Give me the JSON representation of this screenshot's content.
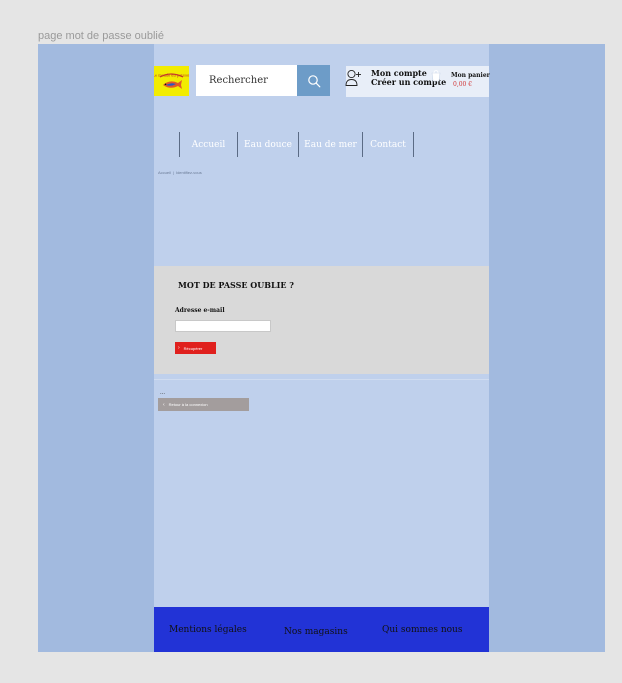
{
  "frame_label": "page mot de passe oublié",
  "header": {
    "logo_alt": "logo",
    "search": {
      "placeholder": "Rechercher",
      "button": "search-icon"
    },
    "account": {
      "line1": "Mon compte",
      "line2": "Créer un compte"
    },
    "cart": {
      "label": "Mon panier",
      "amount": "0,00 €"
    }
  },
  "nav": {
    "items": [
      {
        "label": "Accueil"
      },
      {
        "label": "Eau douce"
      },
      {
        "label": "Eau de mer"
      },
      {
        "label": "Contact"
      }
    ]
  },
  "breadcrumb": {
    "home": "Accueil",
    "separator": "|",
    "current": "Identifiez-vous"
  },
  "form": {
    "title": "MOT DE PASSE OUBLIE ?",
    "email_label": "Adresse e-mail",
    "email_value": "",
    "submit_label": "Récupérer",
    "submit_icon": "chevron-right-icon"
  },
  "login_link": {
    "ellipsis": "...",
    "label": "Retour à la connexion",
    "icon": "chevron-left-icon"
  },
  "footer": {
    "links": [
      {
        "label": "Mentions légales"
      },
      {
        "label": "Nos magasins"
      },
      {
        "label": "Qui sommes nous"
      }
    ]
  },
  "colors": {
    "frame_bg": "#a2badf",
    "page_bg": "#bfd0ec",
    "logo_bg": "#f2ec00",
    "search_button": "#6d9cc8",
    "form_panel": "#d9d9d9",
    "primary_button": "#e0201d",
    "secondary_button": "#a39d9d",
    "footer_bg": "#2233d6"
  }
}
